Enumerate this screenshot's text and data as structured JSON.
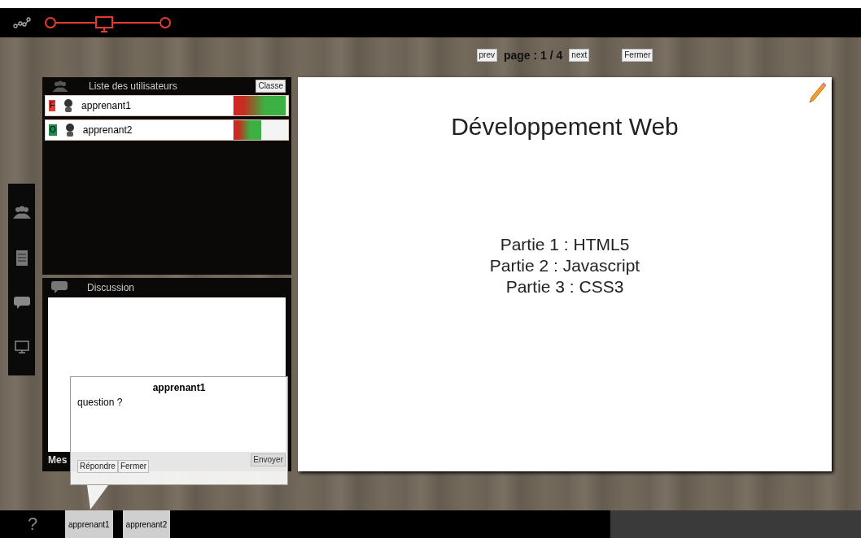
{
  "pager": {
    "prev": "prev",
    "label": "page : 1 / 4",
    "next": "next",
    "close": "Fermer"
  },
  "users_panel": {
    "title": "Liste des utilisateurs",
    "button": "Classe",
    "users": [
      {
        "status": "F",
        "color": "#e53935",
        "name": "apprenant1",
        "level": 0.95
      },
      {
        "status": "O",
        "color": "#1b8a4a",
        "name": "apprenant2",
        "level": 0.5
      }
    ]
  },
  "discussion": {
    "title": "Discussion",
    "message_label": "Mes",
    "send": "Envoyer"
  },
  "popup": {
    "author": "apprenant1",
    "message": "question ?",
    "reply": "Répondre",
    "close": "Fermer"
  },
  "slide": {
    "title": "Développement Web",
    "lines": [
      "Partie 1 : HTML5",
      "Partie 2 : Javascript",
      "Partie 3 : CSS3"
    ]
  },
  "taskbar": {
    "help": "?",
    "users": [
      "apprenant1",
      "apprenant2"
    ]
  }
}
